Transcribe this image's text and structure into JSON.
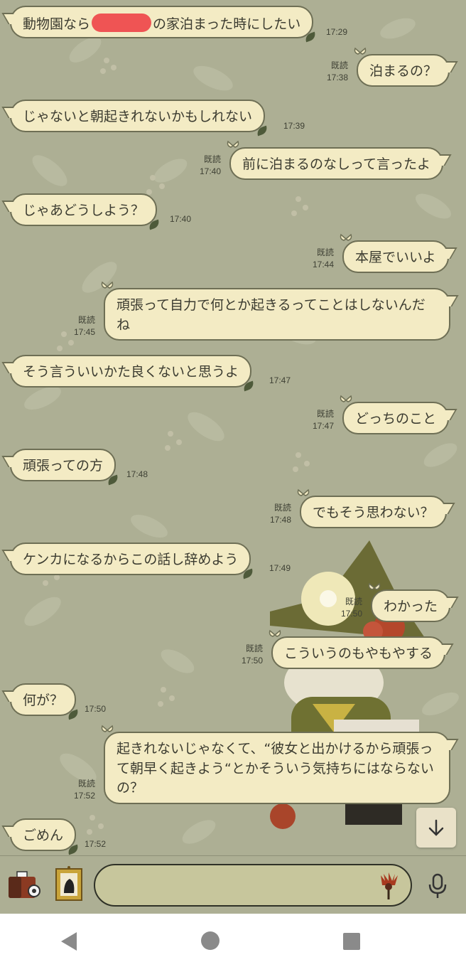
{
  "read_label": "既読",
  "colors": {
    "background": "#adaf94",
    "bubble": "#f3ebc4",
    "bubble_border": "#6e6f55",
    "redaction": "#ef5454"
  },
  "messages": [
    {
      "side": "in",
      "before": "動物園なら",
      "after": "の家泊まった時にしたい",
      "redacted": true,
      "time": "17:29"
    },
    {
      "side": "out",
      "text": "泊まるの？",
      "time": "17:38",
      "read": true
    },
    {
      "side": "in",
      "text": "じゃないと朝起きれないかもしれない",
      "time": "17:39"
    },
    {
      "side": "out",
      "text": "前に泊まるのなしって言ったよ",
      "time": "17:40",
      "read": true
    },
    {
      "side": "in",
      "text": "じゃあどうしよう？",
      "time": "17:40"
    },
    {
      "side": "out",
      "text": "本屋でいいよ",
      "time": "17:44",
      "read": true
    },
    {
      "side": "out",
      "text": "頑張って自力で何とか起きるってことはしないんだね",
      "time": "17:45",
      "read": true
    },
    {
      "side": "in",
      "text": "そう言うい­いかた良くないと思うよ",
      "time": "17:47"
    },
    {
      "side": "out",
      "text": "どっちのこと",
      "time": "17:47",
      "read": true
    },
    {
      "side": "in",
      "text": "頑張っての方",
      "time": "17:48"
    },
    {
      "side": "out",
      "text": "でもそう思わない？",
      "time": "17:48",
      "read": true
    },
    {
      "side": "in",
      "text": "ケンカになるからこの話し辞めよう",
      "time": "17:49"
    },
    {
      "side": "out",
      "text": "わかった",
      "time": "17:50",
      "read": true
    },
    {
      "side": "out",
      "text": "こういうのもやもやする",
      "time": "17:50",
      "read": true
    },
    {
      "side": "in",
      "text": "何が？",
      "time": "17:50"
    },
    {
      "side": "out",
      "text": "起きれないじゃなくて、“彼女と出かけるから頑張って朝早く起きよう“とかそういう気持ちにはならないの？",
      "time": "17:52",
      "read": true
    },
    {
      "side": "in",
      "text": "ごめん",
      "time": "17:52"
    }
  ],
  "input": {
    "placeholder": ""
  },
  "icons": {
    "camera": "camera-icon",
    "album": "picture-frame-icon",
    "sticker": "flower-sticker-icon",
    "mic": "microphone-icon",
    "scroll_down": "arrow-down-icon",
    "nav_back": "back-triangle-icon",
    "nav_home": "home-circle-icon",
    "nav_recents": "recents-square-icon"
  }
}
